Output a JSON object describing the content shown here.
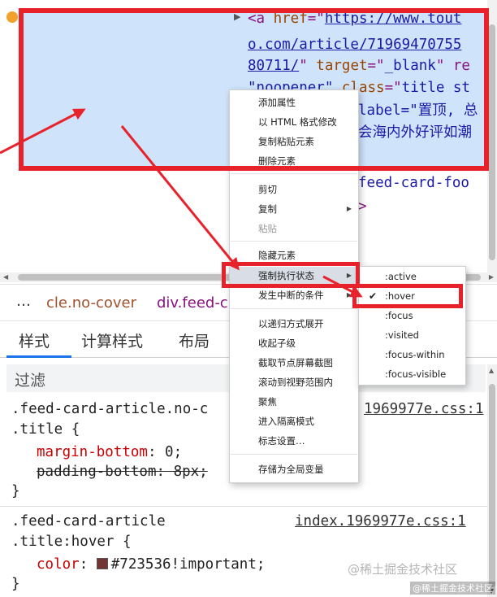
{
  "elements_panel": {
    "line1": {
      "open": "<a ",
      "attr_href": "href",
      "eq": "=\"",
      "href_part1": "https://www.tout"
    },
    "line2": {
      "href_part2": "o.com/article/71969470755"
    },
    "line3": {
      "href_part3": "80711/",
      "rest_quote": "\" ",
      "attr_target": "target",
      "eq": "=\"",
      "target_val": "_blank",
      "tail": "\" re"
    },
    "line4": {
      "val": "\"noopener\" ",
      "attr_class": "class",
      "eq": "=\"",
      "class_val": "title st"
    },
    "line5": {
      "text": "label=\"置顶, 总"
    },
    "line6": {
      "text": "会海内外好评如潮"
    },
    "line7": {
      "text": "feed-card-foo"
    },
    "line8": {
      "text": ">"
    }
  },
  "breadcrumb": {
    "more": "…",
    "item1": "cle.no-cover",
    "item2": "div.feed-c"
  },
  "tabs": {
    "styles": "样式",
    "computed": "计算样式",
    "layout": "布局",
    "overflow": "›"
  },
  "filter": {
    "placeholder": "过滤"
  },
  "styles": {
    "rule1": {
      "selector_line1": ".feed-card-article.no-c",
      "selector_line2": ".title {",
      "source": "1969977e.css:1",
      "prop1": "margin-bottom",
      "val1": "0;",
      "prop2": "padding-bottom: 8px;",
      "close": "}"
    },
    "rule2": {
      "selector_line1": ".feed-card-article",
      "selector_line2": ".title:hover {",
      "source": "index.1969977e.css:1",
      "prop1": "color",
      "val1": "#723536!important;",
      "close": "}"
    }
  },
  "context_menu": {
    "items": [
      "添加属性",
      "以 HTML 格式修改",
      "复制粘贴元素",
      "删除元素",
      "剪切",
      "复制",
      "粘贴",
      "隐藏元素",
      "强制执行状态",
      "发生中断的条件",
      "以递归方式展开",
      "收起子级",
      "截取节点屏幕截图",
      "滚动到视野范围内",
      "聚焦",
      "进入隔离模式",
      "标志设置…",
      "存储为全局变量"
    ]
  },
  "submenu": {
    "items": [
      ":active",
      ":hover",
      ":focus",
      ":visited",
      ":focus-within",
      ":focus-visible"
    ],
    "checked": ":hover"
  },
  "colors": {
    "annotation_red": "#e8222b",
    "selection_blue": "#cfe3fb",
    "swatch": "#723536"
  },
  "watermark": {
    "text": "@稀土掘金技术社区",
    "text2": "@稀土掘金技术社区"
  }
}
